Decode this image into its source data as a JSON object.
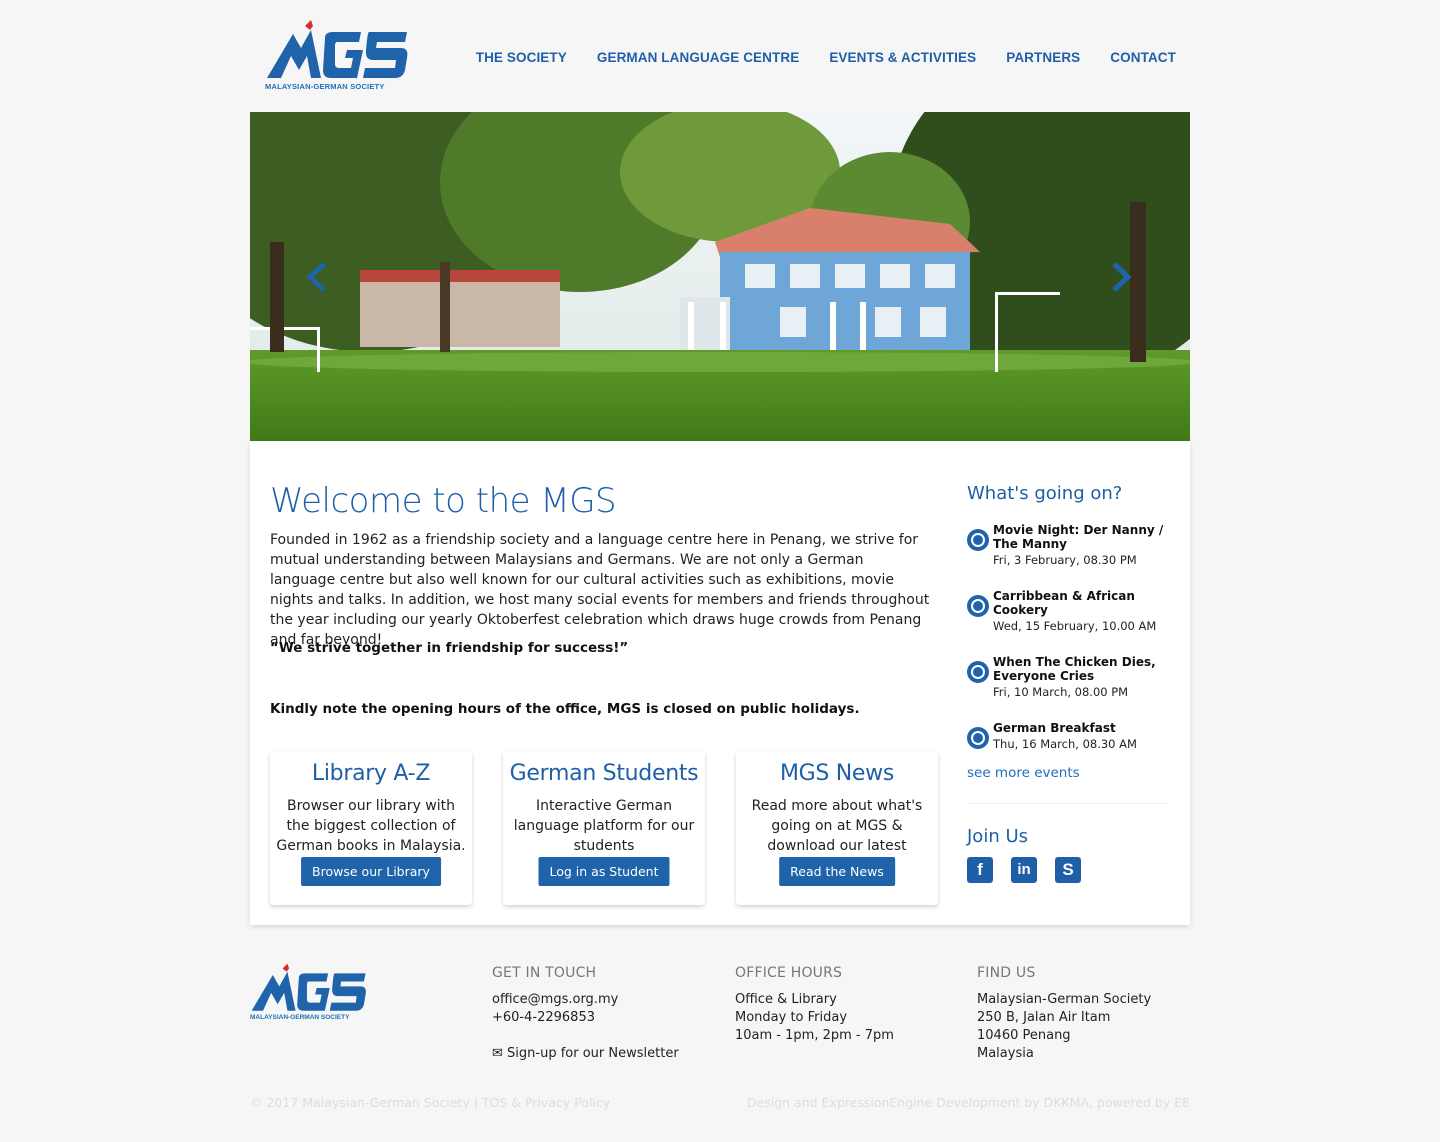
{
  "brand": {
    "logo_text": "MGS",
    "tagline": "MALAYSIAN-GERMAN SOCIETY",
    "color_primary": "#1f5fa8",
    "color_accent": "#d32f2f"
  },
  "nav": {
    "items": [
      "THE SOCIETY",
      "GERMAN LANGUAGE CENTRE",
      "EVENTS & ACTIVITIES",
      "PARTNERS",
      "CONTACT"
    ]
  },
  "hero": {
    "prev_icon": "chevron-left-icon",
    "next_icon": "chevron-right-icon"
  },
  "main": {
    "title": "Welcome to the MGS",
    "intro": "Founded in 1962 as a friendship society and a language centre here in Penang, we strive for mutual understanding between Malaysians and Germans. We are not only a German language centre but also well known for our cultural activities such as exhibitions, movie nights and talks. In addition, we host many social events for members and friends throughout the year including our yearly Oktoberfest celebration which draws huge crowds from Penang and far beyond!",
    "motto": "“We strive together in friendship for success!”",
    "note": "Kindly note the opening hours of the office, MGS is closed on public holidays."
  },
  "cards": [
    {
      "title": "Library A-Z",
      "text": "Browser our library with the biggest collection of German books in Malaysia.",
      "button": "Browse our Library"
    },
    {
      "title": "German Students",
      "text": "Interactive German language platform for our students",
      "button": "Log in as Student"
    },
    {
      "title": "MGS News",
      "text": "Read more about what's going on at MGS & download our latest Newsletter.",
      "button": "Read the News"
    }
  ],
  "sidebar": {
    "heading": "What's going on?",
    "events": [
      {
        "title": "Movie Night: Der Nanny / The Manny",
        "date": "Fri, 3 February, 08.30 PM",
        "icon": "film-icon"
      },
      {
        "title": "Carribbean & African Cookery",
        "date": "Wed, 15 February, 10.00 AM",
        "icon": "cooking-pot-icon"
      },
      {
        "title": "When The Chicken Dies, Everyone Cries",
        "date": "Fri, 10 March, 08.00 PM",
        "icon": "theatre-icon"
      },
      {
        "title": "German Breakfast",
        "date": "Thu, 16 March, 08.30 AM",
        "icon": "bread-icon"
      }
    ],
    "see_more": "see more events",
    "join_heading": "Join Us",
    "social": [
      {
        "label": "f",
        "icon": "facebook-icon"
      },
      {
        "label": "in",
        "icon": "linkedin-icon"
      },
      {
        "label": "S",
        "icon": "skype-icon"
      }
    ]
  },
  "footer": {
    "contact_heading": "GET IN TOUCH",
    "email": "office@mgs.org.my",
    "phone": "+60-4-2296853",
    "newsletter": "Sign-up for our Newsletter",
    "newsletter_icon": "envelope-icon",
    "hours_heading": "OFFICE HOURS",
    "hours_lines": [
      "Office & Library",
      "Monday to Friday",
      "10am - 1pm, 2pm - 7pm"
    ],
    "find_heading": "FIND US",
    "address_lines": [
      "Malaysian-German Society",
      "250 B, Jalan Air Itam",
      "10460 Penang",
      "Malaysia"
    ],
    "copyright": "© 2017 Malaysian-German Society | TOS & Privacy Policy",
    "credit": "Design and ExpressionEngine Development by DKKMA, powered by EE"
  }
}
